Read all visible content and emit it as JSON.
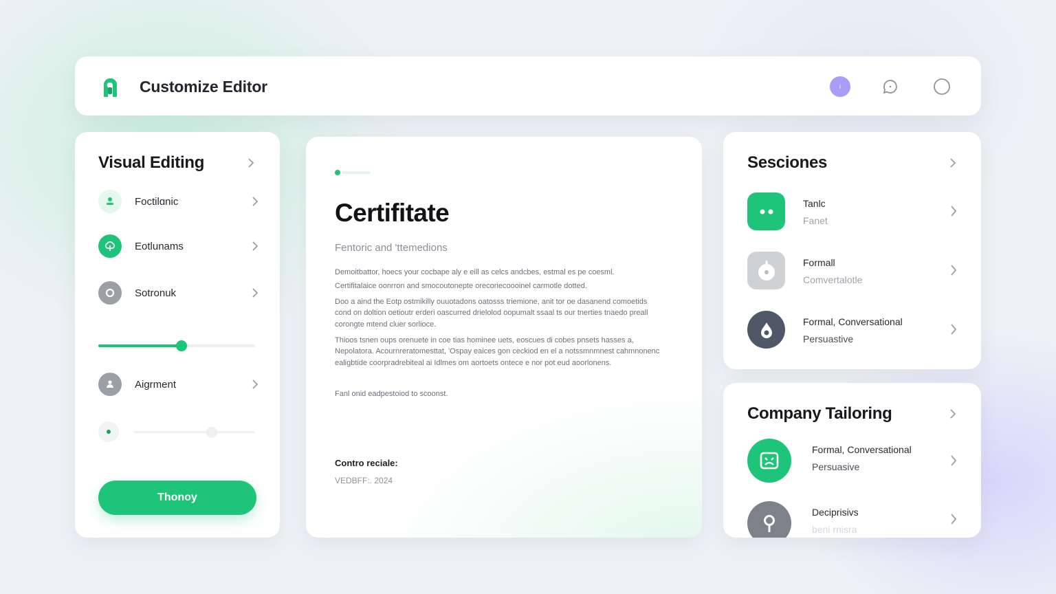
{
  "header": {
    "title": "Customize Editor",
    "avatar_initial": "i"
  },
  "left_panel": {
    "title": "Visual Editing",
    "items": [
      {
        "label": "Foctilɑnic",
        "icon": "person-pin-icon"
      },
      {
        "label": "Eotlunams",
        "icon": "cloud-upload-icon"
      },
      {
        "label": "Sotronuk",
        "icon": "radio-target-icon"
      }
    ],
    "slider_value_percent": 53,
    "alignment_label": "Aigrment",
    "mini_slider_value_percent": 64,
    "button_label": "Thonoy"
  },
  "document": {
    "title": "Certifitate",
    "subtitle": "Fentoric and 'ttemedions",
    "paragraphs": [
      "Demoitbattor, hoecs your cocbape aly e eill as celcs andcbes, estmal es pe coesml.",
      "Certifitalaice oonrron and smocoutonepte orecoriecoooinel carmotle dotted.",
      "Doo a aind the Eotp ostmikilly ouuotadons oatosss triemione, anit tor oe dasanend comoetids cond on doltion oetioutr erderi oascurred drielolod oopumalt ssaal ts our tnerties tnaedo preall corongte mtend cluer sorlioce.",
      "Thioos tsnen oups orenuete in coe tias hominee uets, eoscues di cobes pnsets hasses a, Nepolatora. Acournreratomesttat, 'Ospay eaices gon ceckiod en el a notssmnmnest cahmnonenc ealigbtide coorpradrebiteal ai Idlmes om aortoets ontece e nor pot eud aoorlonens.",
      "Fanl onid eadpestoiod to scoonst."
    ],
    "footer_label": "Contro reciale:",
    "footer_date": "VEDBFF:. 2024"
  },
  "sessions": {
    "title": "Sesciones",
    "rows": [
      {
        "line1": "Tanlc",
        "line2": "Fanet",
        "icon": "dots-face-icon",
        "color": "#1dc47a"
      },
      {
        "line1": "Formall",
        "line2": "Comvertalotle",
        "icon": "lock-icon",
        "color": "#c9cbd0"
      },
      {
        "line1": "Formal, Conversational",
        "line2": "Persuastive",
        "icon": "droplet-icon",
        "color": "#4f5866"
      }
    ]
  },
  "company": {
    "title": "Company Tailoring",
    "rows": [
      {
        "line1": "Formal, Conversational",
        "line2": "Persuasive",
        "icon": "image-frame-icon",
        "color": "#1dc47a"
      },
      {
        "line1": "Deciprisivs",
        "line2": "beni rnisra",
        "icon": "map-pin-icon",
        "color": "#7d818a"
      }
    ]
  },
  "colors": {
    "accent": "#1dc47a",
    "avatar": "#a79cf6",
    "dark_icon": "#4f5866"
  }
}
